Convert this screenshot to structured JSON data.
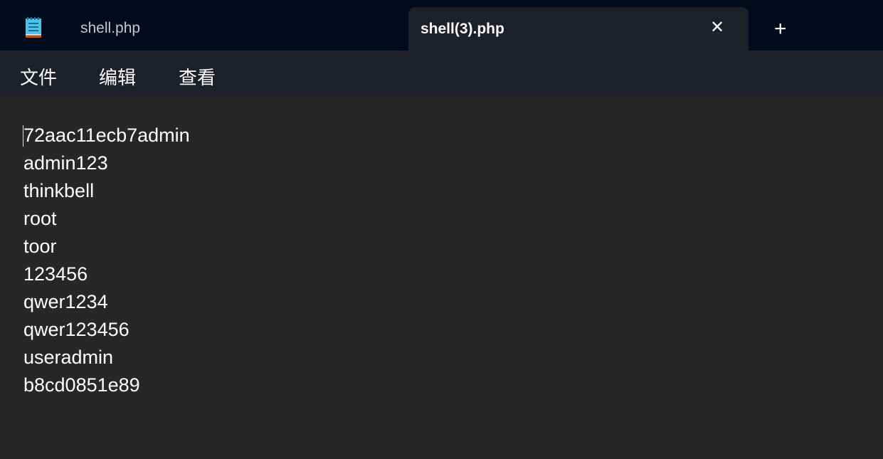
{
  "tabs": [
    {
      "label": "shell.php",
      "active": false
    },
    {
      "label": "shell(3).php",
      "active": true
    }
  ],
  "icons": {
    "app": "notepad-icon",
    "close": "close-icon",
    "new_tab": "plus-icon"
  },
  "tab_close_glyph": "✕",
  "new_tab_glyph": "+",
  "menu": [
    "文件",
    "编辑",
    "查看"
  ],
  "content_lines": [
    "72aac11ecb7admin",
    "admin123",
    "thinkbell",
    "root",
    "toor",
    "123456",
    "qwer1234",
    "qwer123456",
    "useradmin",
    "b8cd0851e89"
  ],
  "colors": {
    "titlebar": "#010b1c",
    "tab_active": "#1e2029",
    "editor_bg": "#272727"
  }
}
